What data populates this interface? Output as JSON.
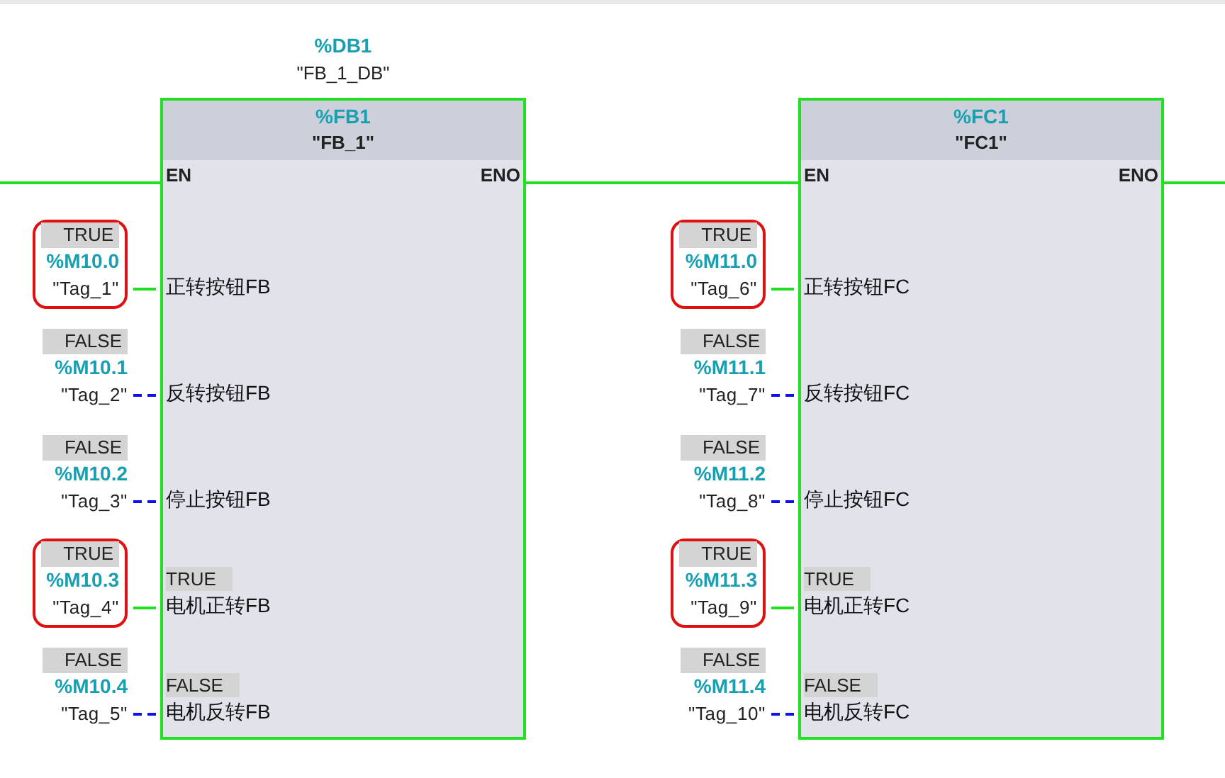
{
  "blocks": [
    {
      "instance_db": {
        "address": "%DB1",
        "name": "\"FB_1_DB\""
      },
      "address": "%FB1",
      "name": "\"FB_1\"",
      "en": "EN",
      "eno": "ENO",
      "inputs": [
        {
          "value": "TRUE",
          "address": "%M10.0",
          "tag": "\"Tag_1\"",
          "param": "正转按钮FB",
          "highlighted": true
        },
        {
          "value": "FALSE",
          "address": "%M10.1",
          "tag": "\"Tag_2\"",
          "param": "反转按钮FB",
          "highlighted": false
        },
        {
          "value": "FALSE",
          "address": "%M10.2",
          "tag": "\"Tag_3\"",
          "param": "停止按钮FB",
          "highlighted": false
        },
        {
          "value": "TRUE",
          "address": "%M10.3",
          "tag": "\"Tag_4\"",
          "param": "电机正转FB",
          "param_value": "TRUE",
          "highlighted": true
        },
        {
          "value": "FALSE",
          "address": "%M10.4",
          "tag": "\"Tag_5\"",
          "param": "电机反转FB",
          "param_value": "FALSE",
          "highlighted": false
        }
      ]
    },
    {
      "address": "%FC1",
      "name": "\"FC1\"",
      "en": "EN",
      "eno": "ENO",
      "inputs": [
        {
          "value": "TRUE",
          "address": "%M11.0",
          "tag": "\"Tag_6\"",
          "param": "正转按钮FC",
          "highlighted": true
        },
        {
          "value": "FALSE",
          "address": "%M11.1",
          "tag": "\"Tag_7\"",
          "param": "反转按钮FC",
          "highlighted": false
        },
        {
          "value": "FALSE",
          "address": "%M11.2",
          "tag": "\"Tag_8\"",
          "param": "停止按钮FC",
          "highlighted": false
        },
        {
          "value": "TRUE",
          "address": "%M11.3",
          "tag": "\"Tag_9\"",
          "param": "电机正转FC",
          "param_value": "TRUE",
          "highlighted": true
        },
        {
          "value": "FALSE",
          "address": "%M11.4",
          "tag": "\"Tag_10\"",
          "param": "电机反转FC",
          "param_value": "FALSE",
          "highlighted": false
        }
      ]
    }
  ]
}
